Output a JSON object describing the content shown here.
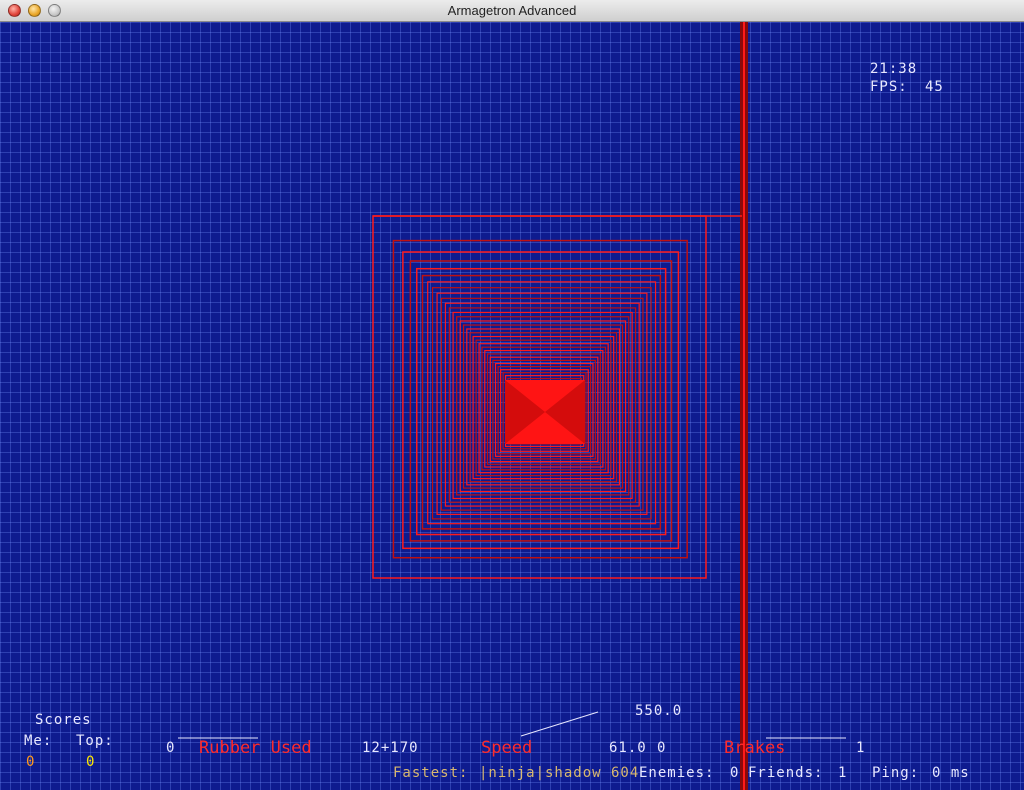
{
  "window": {
    "title": "Armagetron Advanced"
  },
  "hud": {
    "clock": "21:38",
    "fps_label": "FPS:",
    "fps_value": "45",
    "scores_label": "Scores",
    "me_label": "Me:",
    "top_label": "Top:",
    "me_score": "0",
    "top_score": "0",
    "rubber_value": "0",
    "rubber_label": "Rubber Used",
    "rubber_max": "12+170",
    "speed_label": "Speed",
    "speed_max_indicator": "550.0",
    "speed_value": "61.0",
    "speed_extra": "0",
    "brakes_label": "Brakes",
    "brakes_value": "1",
    "fastest_label": "Fastest:",
    "fastest_player": "|ninja|shadow 604",
    "enemies_label": "Enemies:",
    "enemies_value": "0",
    "friends_label": "Friends:",
    "friends_value": "1",
    "ping_label": "Ping:",
    "ping_value": "0 ms"
  },
  "colors": {
    "background": "#0e1b8f",
    "grid": "#7896ff",
    "cycle_wall": "#ff1a1a",
    "hud_text": "#e8e8ff",
    "hud_label_red": "#ff2b2b"
  }
}
